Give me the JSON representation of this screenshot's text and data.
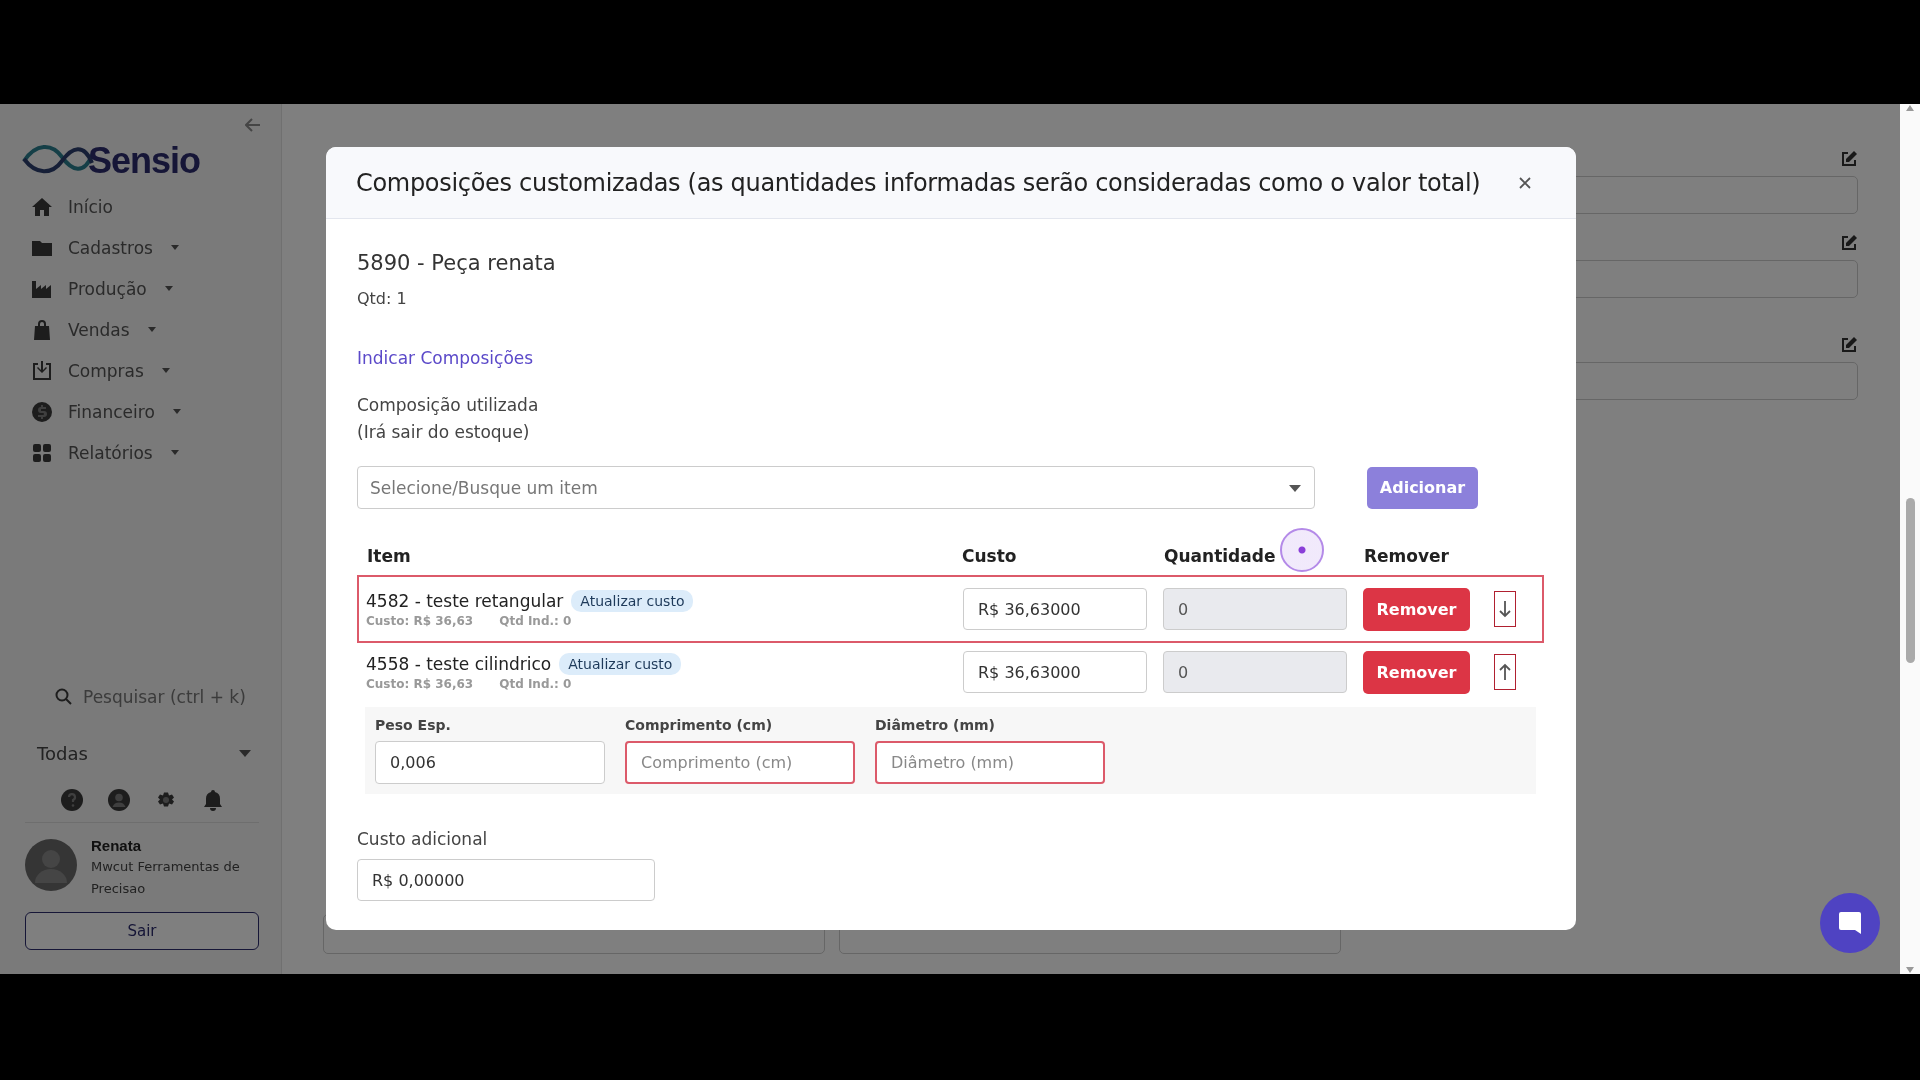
{
  "sidebar": {
    "logo": "Sensio",
    "items": [
      {
        "label": "Início",
        "dropdown": false
      },
      {
        "label": "Cadastros",
        "dropdown": true
      },
      {
        "label": "Produção",
        "dropdown": true
      },
      {
        "label": "Vendas",
        "dropdown": true
      },
      {
        "label": "Compras",
        "dropdown": true
      },
      {
        "label": "Financeiro",
        "dropdown": true
      },
      {
        "label": "Relatórios",
        "dropdown": true
      }
    ],
    "search": {
      "placeholder": "Pesquisar (ctrl + k)"
    },
    "filter": {
      "value": "Todas"
    },
    "user": {
      "name": "Renata",
      "company": "Mwcut Ferramentas de Precisao"
    },
    "logout": "Sair"
  },
  "modal": {
    "title": "Composições customizadas (as quantidades informadas serão consideradas como o valor total)",
    "product": "5890 - Peça renata",
    "qty": "Qtd: 1",
    "link": "Indicar Composições",
    "label": "Composição utilizada",
    "note": "(Irá sair do estoque)",
    "select": {
      "placeholder": "Selecione/Busque um item"
    },
    "add_button": "Adicionar",
    "table": {
      "columns": [
        "Item",
        "Custo",
        "Quantidade",
        "Remover"
      ],
      "rows": [
        {
          "name": "4582 - teste retangular",
          "badge": "Atualizar custo",
          "cost_note": "Custo: R$ 36,63",
          "qty_note": "Qtd Ind.: 0",
          "cost": "R$ 36,63000",
          "quantity": "0",
          "quantity_disabled": true,
          "button": "Remover",
          "kind": "down",
          "highlighted": true
        },
        {
          "name": "4558 - teste cilindrico",
          "badge": "Atualizar custo",
          "cost_note": "Custo: R$ 36,63",
          "qty_note": "Qtd Ind.: 0",
          "cost": "R$ 36,63000",
          "quantity": "0",
          "quantity_disabled": true,
          "button": "Remover",
          "kind": "up",
          "highlighted": false
        }
      ]
    },
    "params": [
      {
        "label": "Peso Esp.",
        "value": "0,006",
        "invalid": false
      },
      {
        "label": "Comprimento (cm)",
        "placeholder": "Comprimento (cm)",
        "invalid": true
      },
      {
        "label": "Diâmetro (mm)",
        "placeholder": "Diâmetro (mm)",
        "invalid": true
      }
    ],
    "extra_cost": {
      "label": "Custo adicional",
      "value": "R$ 0,00000"
    }
  }
}
